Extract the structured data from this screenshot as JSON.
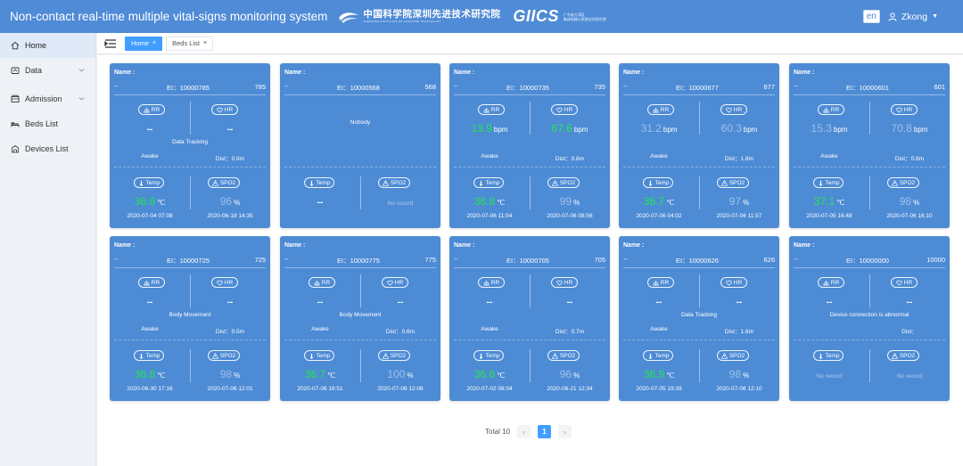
{
  "header": {
    "title": "Non-contact real-time multiple vital-signs monitoring system",
    "logo1_cn": "中国科学院深圳先进技术研究院",
    "logo1_en": "SHENZHEN INSTITUTES OF ADVANCED TECHNOLOGY",
    "logo2": "GIICS",
    "logo2_sub1": "广东省大湾区",
    "logo2_sub2": "集成电路与系统应用研究院",
    "lang": "en",
    "user": "Zkong"
  },
  "sidebar": {
    "items": [
      {
        "label": "Home",
        "icon": "home-icon"
      },
      {
        "label": "Data",
        "icon": "data-icon"
      },
      {
        "label": "Admission",
        "icon": "admission-icon"
      },
      {
        "label": "Beds List",
        "icon": "bed-icon"
      },
      {
        "label": "Devices List",
        "icon": "devices-icon"
      }
    ]
  },
  "tabs": [
    {
      "label": "Home",
      "close": "×"
    },
    {
      "label": "Beds List",
      "close": "×"
    }
  ],
  "labels": {
    "name": "Name :",
    "dash": "--",
    "rr": "RR",
    "hr": "HR",
    "temp": "Temp",
    "spo2": "SPO2",
    "bpm": "bpm",
    "celsius": "℃",
    "percent": "%",
    "no_record": "No record"
  },
  "cards": [
    {
      "ei": "EI：10000785",
      "num": "785",
      "nobody": "",
      "status": "Data Tracking",
      "awake": "Awake",
      "dist": "Dist：0.9m",
      "rr": "--",
      "rr_unit": "",
      "hr": "--",
      "hr_unit": "",
      "temp": "36.9",
      "temp_unit": "℃",
      "spo2": "96",
      "spo2_unit": "%",
      "t1": "2020-07-04 07:08",
      "t2": "2020-06-18 14:35"
    },
    {
      "ei": "EI：10000568",
      "num": "568",
      "nobody": "Nobody",
      "status": "",
      "awake": "",
      "dist": "",
      "rr": "",
      "rr_unit": "",
      "hr": "",
      "hr_unit": "",
      "temp": "--",
      "temp_unit": "",
      "spo2": "No record",
      "spo2_unit": "",
      "t1": "",
      "t2": ""
    },
    {
      "ei": "EI：10000735",
      "num": "735",
      "nobody": "",
      "status": "",
      "awake": "Awake",
      "dist": "Dist：0.8m",
      "rr": "13.9",
      "rr_unit": "bpm",
      "hr": "67.6",
      "hr_unit": "bpm",
      "temp": "36.8",
      "temp_unit": "℃",
      "spo2": "99",
      "spo2_unit": "%",
      "t1": "2020-07-06 11:54",
      "t2": "2020-07-06 08:56"
    },
    {
      "ei": "EI：10000677",
      "num": "677",
      "nobody": "",
      "status": "",
      "awake": "Awake",
      "dist": "Dist：1.8m",
      "rr": "31.2",
      "rr_unit": "bpm",
      "hr": "60.3",
      "hr_unit": "bpm",
      "temp": "36.7",
      "temp_unit": "℃",
      "spo2": "97",
      "spo2_unit": "%",
      "t1": "2020-07-06 04:02",
      "t2": "2020-07-06 11:57"
    },
    {
      "ei": "EI：10000601",
      "num": "601",
      "nobody": "",
      "status": "",
      "awake": "Awake",
      "dist": "Dist：0.8m",
      "rr": "15.3",
      "rr_unit": "bpm",
      "hr": "70.8",
      "hr_unit": "bpm",
      "temp": "37.1",
      "temp_unit": "℃",
      "spo2": "98",
      "spo2_unit": "%",
      "t1": "2020-07-05 16:48",
      "t2": "2020-07-06 16:10"
    },
    {
      "ei": "EI：10000725",
      "num": "725",
      "nobody": "",
      "status": "Body Movement",
      "awake": "Awake",
      "dist": "Dist：0.5m",
      "rr": "--",
      "rr_unit": "",
      "hr": "--",
      "hr_unit": "",
      "temp": "36.8",
      "temp_unit": "℃",
      "spo2": "98",
      "spo2_unit": "%",
      "t1": "2020-06-30 17:16",
      "t2": "2020-07-06 12:01"
    },
    {
      "ei": "EI：10000775",
      "num": "775",
      "nobody": "",
      "status": "Body Movement",
      "awake": "Awake",
      "dist": "Dist：0.6m",
      "rr": "--",
      "rr_unit": "",
      "hr": "--",
      "hr_unit": "",
      "temp": "36.7",
      "temp_unit": "℃",
      "spo2": "100",
      "spo2_unit": "%",
      "t1": "2020-07-06 16:51",
      "t2": "2020-07-06 12:08"
    },
    {
      "ei": "EI：10000705",
      "num": "705",
      "nobody": "",
      "status": "",
      "awake": "Awake",
      "dist": "Dist：0.7m",
      "rr": "--",
      "rr_unit": "",
      "hr": "--",
      "hr_unit": "",
      "temp": "36.6",
      "temp_unit": "℃",
      "spo2": "96",
      "spo2_unit": "%",
      "t1": "2020-07-02 08:04",
      "t2": "2020-06-21 12:34"
    },
    {
      "ei": "EI：10000626",
      "num": "626",
      "nobody": "",
      "status": "Data Tracking",
      "awake": "Awake",
      "dist": "Dist：1.6m",
      "rr": "--",
      "rr_unit": "",
      "hr": "--",
      "hr_unit": "",
      "temp": "36.9",
      "temp_unit": "℃",
      "spo2": "98",
      "spo2_unit": "%",
      "t1": "2020-07-05 19:39",
      "t2": "2020-07-06 12:10"
    },
    {
      "ei": "EI：10000000",
      "num": "10000",
      "nobody": "",
      "status": "Device connection is abnormal",
      "awake": "",
      "dist": "Dist：",
      "rr": "--",
      "rr_unit": "",
      "hr": "--",
      "hr_unit": "",
      "temp": "No record",
      "temp_unit": "",
      "spo2": "No record",
      "spo2_unit": "",
      "t1": "",
      "t2": ""
    }
  ],
  "pagination": {
    "total": "Total 10",
    "prev": "‹",
    "page": "1",
    "next": "›"
  },
  "colors": {
    "header": "#4f8bd6",
    "card": "#4d8bd5",
    "good_value": "#23e84a",
    "active_tab": "#409eff"
  }
}
